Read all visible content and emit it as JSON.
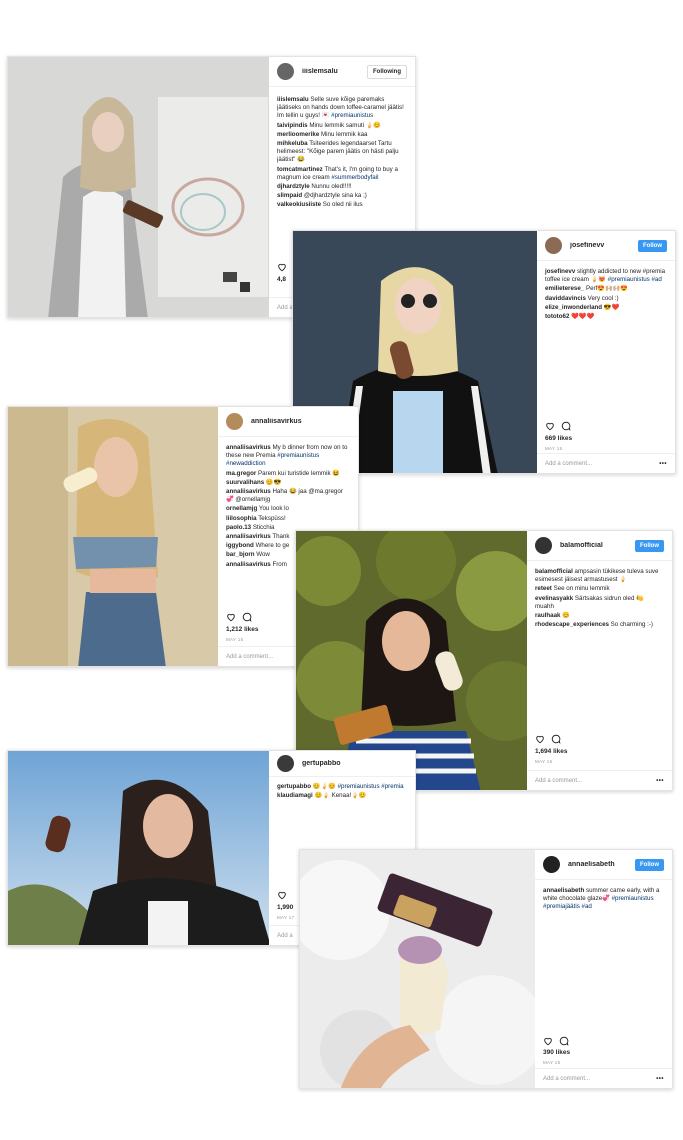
{
  "posts": [
    {
      "user": "iiislemsalu",
      "follow_label": "Following",
      "comments": [
        {
          "user": "iiislemsalu",
          "text": "Selle suve kõige paremaks jäätiseks on hands down toffee-caramel jäätis!\nIm tellin u guys! 💌 ",
          "tag": "#premiaunistus"
        },
        {
          "user": "taivipindis",
          "text": "Minu lemmik samuti 🍦😊"
        },
        {
          "user": "merlioomerike",
          "text": "Minu lemmik kaa"
        },
        {
          "user": "mihkeluba",
          "text": "Tsiteerides legendaarset Tartu helimeest: \"Kõige parem jäätis on hästi palju jäätist\" 😂"
        },
        {
          "user": "tomcatmartinez",
          "text": "That's it, I'm going to buy a magnum ice cream ",
          "tag": "#summerbodyfail"
        },
        {
          "user": "djhardztyle",
          "text": "Nunnu oled!!!!!"
        },
        {
          "user": "slimpaid",
          "text": "@djhardztyle sina ka ;)"
        },
        {
          "user": "valkeokiusiiste",
          "text": "So oled nii ilus"
        }
      ],
      "likes": "4,8",
      "date": "",
      "add_comment": "Add a"
    },
    {
      "user": "josefinevv",
      "follow_label": "Follow",
      "comments": [
        {
          "user": "josefinevv",
          "text": "slightly addicted to new #premia toffee ice cream 🍦😻 ",
          "tag": "#premiaunistus #ad"
        },
        {
          "user": "emilieterese_",
          "text": "Perf😍🙌🏼🙌🏼😍"
        },
        {
          "user": "daviddavincis",
          "text": "Very cool :)"
        },
        {
          "user": "elize_inwonderland",
          "text": "😎❤️"
        },
        {
          "user": "tototo62",
          "text": "❤️❤️❤️"
        }
      ],
      "likes": "669 likes",
      "date": "MAY 15",
      "add_comment": "Add a comment..."
    },
    {
      "user": "annaliisavirkus",
      "follow_label": "",
      "comments": [
        {
          "user": "annaliisavirkus",
          "text": "My b dinner from now on to these new Premia ",
          "tag": "#premiaunistus #newaddiction"
        },
        {
          "user": "ma.gregor",
          "text": "Parem kui turistide lemmik 😆"
        },
        {
          "user": "suurvalihans",
          "text": "😊😎"
        },
        {
          "user": "annaliisavirkus",
          "text": "Haha 😂 jaa @ma.gregor 💞 @ornellamjg"
        },
        {
          "user": "ornellamjg",
          "text": "You look lo"
        },
        {
          "user": "liilosophia",
          "text": "Tekspüss!"
        },
        {
          "user": "paolo.13",
          "text": "Sticchia"
        },
        {
          "user": "annaliisavirkus",
          "text": "Thank"
        },
        {
          "user": "iggybond",
          "text": "Where to ge"
        },
        {
          "user": "bar_bjorn",
          "text": "Wow"
        },
        {
          "user": "annaliisavirkus",
          "text": "From"
        }
      ],
      "likes": "1,212 likes",
      "date": "MAY 15",
      "add_comment": "Add a comment..."
    },
    {
      "user": "balamofficial",
      "follow_label": "Follow",
      "comments": [
        {
          "user": "balamofficial",
          "text": "ampsasin tükikese tuleva suve esimesest jäisest armastusest 🍦"
        },
        {
          "user": "reteet",
          "text": "See on minu lemmik"
        },
        {
          "user": "evelinasyakk",
          "text": "Särtsakas sidrun oled 🍋 muahh"
        },
        {
          "user": "raulhaak",
          "text": "😊"
        },
        {
          "user": "rhodescape_experiences",
          "text": "So charming :-)"
        }
      ],
      "likes": "1,694 likes",
      "date": "MAY 15",
      "add_comment": "Add a comment..."
    },
    {
      "user": "gertupabbo",
      "follow_label": "",
      "comments": [
        {
          "user": "gertupabbo",
          "text": "😊🍦😊 ",
          "tag": "#premiaunistus #premia"
        },
        {
          "user": "klaudiamagi",
          "text": "😊🍦 Kenaa!🍦😊"
        }
      ],
      "likes": "1,990",
      "date": "MAY 17",
      "add_comment": "Add a"
    },
    {
      "user": "annaelisabeth",
      "follow_label": "Follow",
      "comments": [
        {
          "user": "annaelisabeth",
          "text": "summer came early, with a white chocolate glaze💞 ",
          "tag": "#premiaunistus #premiajäätis #ad"
        }
      ],
      "likes": "390 likes",
      "date": "MAY 15",
      "add_comment": "Add a comment..."
    }
  ]
}
